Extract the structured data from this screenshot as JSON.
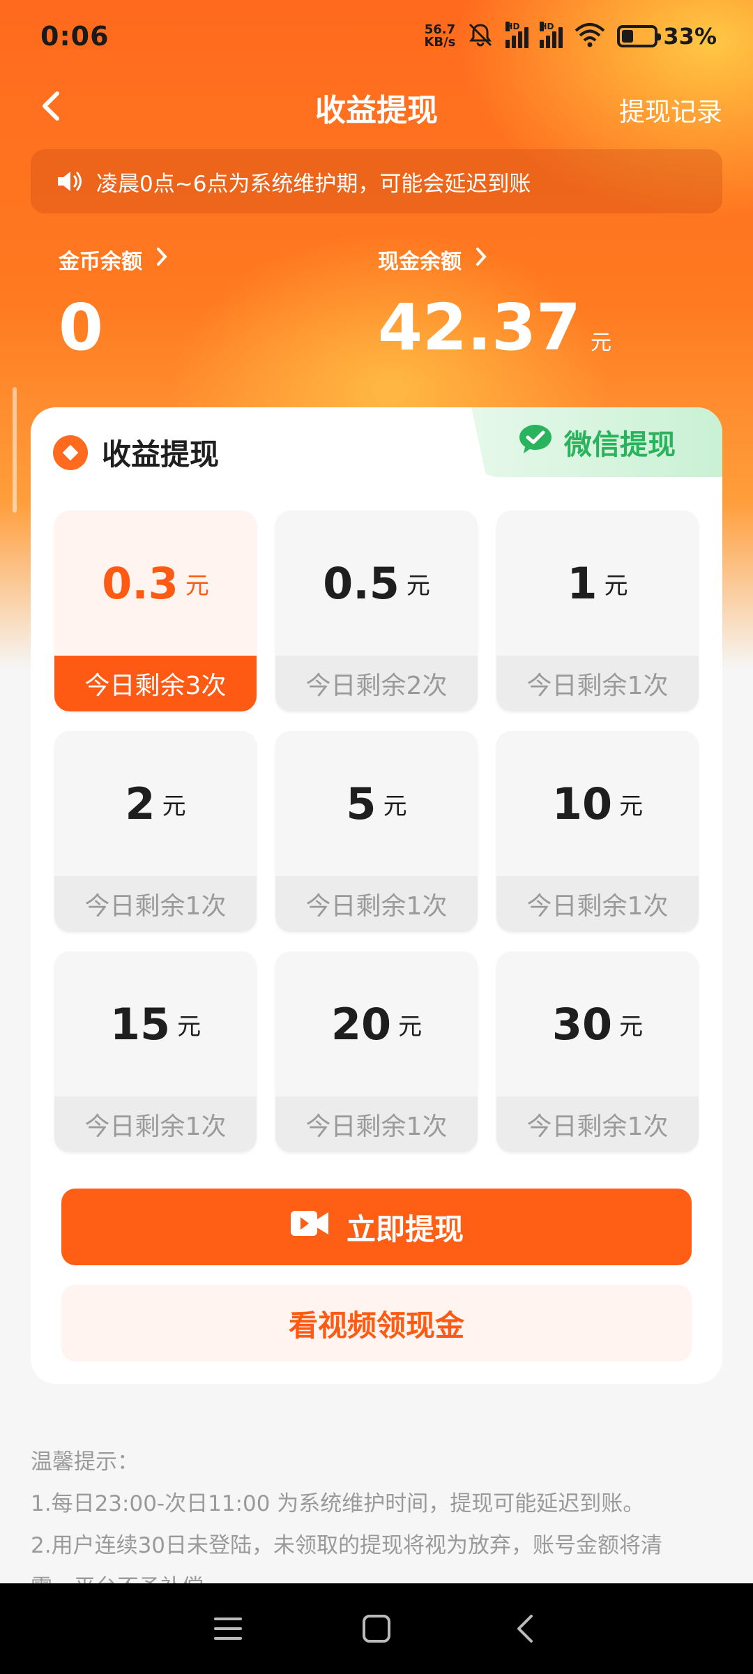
{
  "status_bar": {
    "time": "0:06",
    "net_speed_value": "56.7",
    "net_speed_unit": "KB/s",
    "signal_label": "HD",
    "battery_percent": "33%",
    "battery_level": 0.33
  },
  "nav": {
    "back_icon": "chevron-left-icon",
    "title": "收益提现",
    "history_label": "提现记录"
  },
  "notice": {
    "icon": "speaker-icon",
    "text": "凌晨0点~6点为系统维护期，可能会延迟到账"
  },
  "balances": {
    "coin_label": "金币余额",
    "coin_value": "0",
    "cash_label": "现金余额",
    "cash_value": "42.37",
    "cash_unit": "元"
  },
  "withdraw_card": {
    "title": "收益提现",
    "wechat_label": "微信提现",
    "options": [
      {
        "amount": "0.3",
        "unit": "元",
        "remaining": "今日剩余3次",
        "selected": true
      },
      {
        "amount": "0.5",
        "unit": "元",
        "remaining": "今日剩余2次",
        "selected": false
      },
      {
        "amount": "1",
        "unit": "元",
        "remaining": "今日剩余1次",
        "selected": false
      },
      {
        "amount": "2",
        "unit": "元",
        "remaining": "今日剩余1次",
        "selected": false
      },
      {
        "amount": "5",
        "unit": "元",
        "remaining": "今日剩余1次",
        "selected": false
      },
      {
        "amount": "10",
        "unit": "元",
        "remaining": "今日剩余1次",
        "selected": false
      },
      {
        "amount": "15",
        "unit": "元",
        "remaining": "今日剩余1次",
        "selected": false
      },
      {
        "amount": "20",
        "unit": "元",
        "remaining": "今日剩余1次",
        "selected": false
      },
      {
        "amount": "30",
        "unit": "元",
        "remaining": "今日剩余1次",
        "selected": false
      }
    ],
    "withdraw_button": "立即提现",
    "video_button": "看视频领现金"
  },
  "tips": {
    "title": "温馨提示：",
    "line1": "1.每日23:00-次日11:00 为系统维护时间，提现可能延迟到账。",
    "line2": "2.用户连续30日未登陆，未领取的提现将视为放弃，账号金额将清",
    "line3": "零，平台不予补偿。"
  },
  "colors": {
    "accent": "#ff5a14",
    "wechat_green": "#29b35d"
  }
}
